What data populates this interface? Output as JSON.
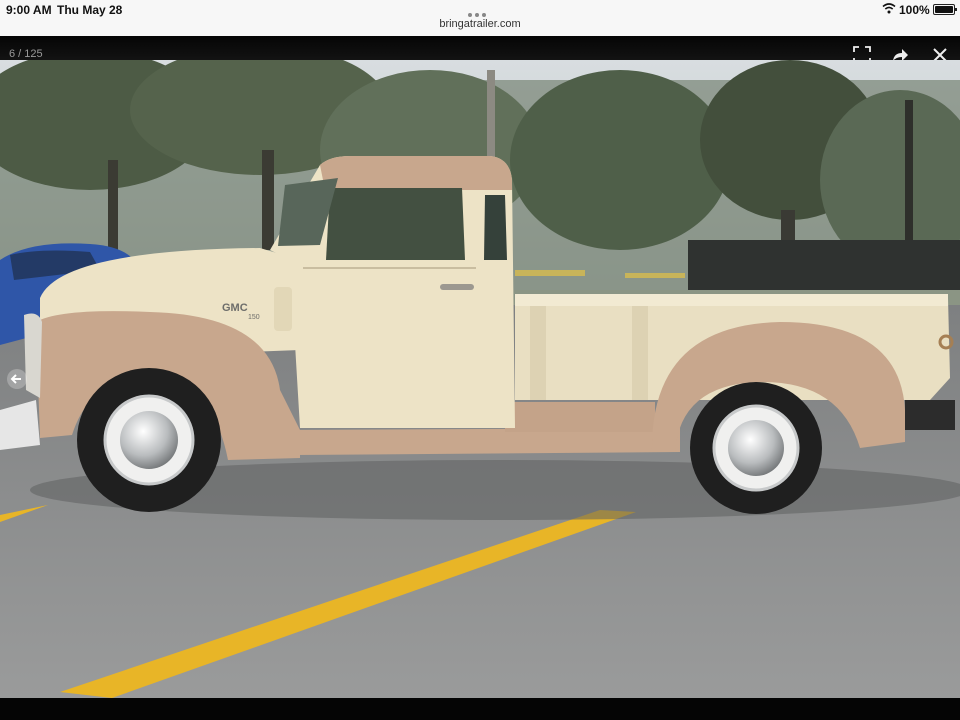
{
  "status_bar": {
    "time": "9:00 AM",
    "date": "Thu May 28",
    "url": "bringatrailer.com",
    "battery": "100%",
    "icons": [
      "multitask-dots-icon",
      "wifi-icon",
      "battery-icon"
    ]
  },
  "viewer": {
    "counter": "6 / 125",
    "buttons": [
      "fullscreen-icon",
      "share-icon",
      "close-icon"
    ],
    "nav": [
      "prev-arrow-icon"
    ]
  },
  "photo": {
    "badge": "GMC",
    "badge_sub": "150",
    "colors": {
      "body_cream": "#ede3c6",
      "fenders_tan": "#c8a78d",
      "pavement": "#8e8f8f",
      "parking_line": "#e8b527",
      "blue_car": "#2f56a8"
    }
  }
}
